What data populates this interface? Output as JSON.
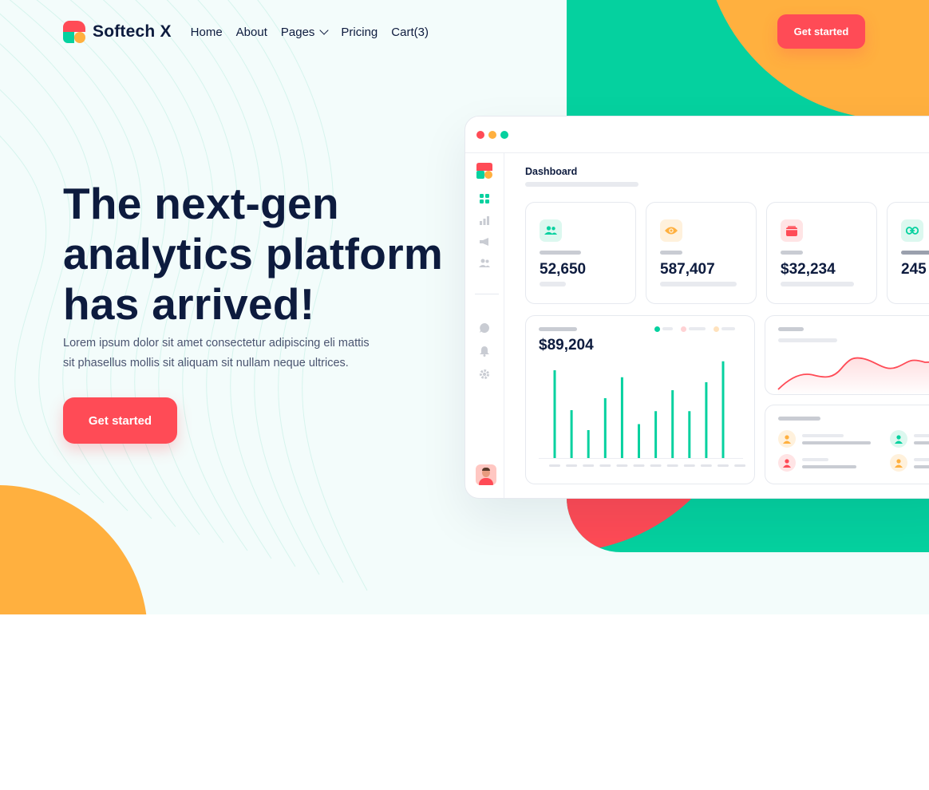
{
  "brand": {
    "name": "Softech X"
  },
  "nav": {
    "items": [
      {
        "label": "Home"
      },
      {
        "label": "About"
      },
      {
        "label": "Pages"
      },
      {
        "label": "Pricing"
      },
      {
        "label": "Cart(3)"
      }
    ],
    "cta_label": "Get started"
  },
  "hero": {
    "headline_lines": [
      "The next-gen",
      "analytics platform",
      "has arrived!"
    ],
    "subtext_lines": [
      "Lorem ipsum dolor sit amet consectetur adipiscing eli mattis",
      "sit phasellus mollis sit aliquam sit nullam neque ultrices."
    ],
    "cta_label": "Get started"
  },
  "colors": {
    "primary_red": "#ff4b56",
    "teal": "#05d19f",
    "orange": "#ffb03f",
    "navy": "#0d1b3e",
    "background": "#f3fcfb"
  },
  "dashboard": {
    "title": "Dashboard",
    "stats": [
      {
        "icon": "users-icon",
        "value": "52,650",
        "color": "#05d19f",
        "bg": "#dcf8ef"
      },
      {
        "icon": "eye-icon",
        "value": "587,407",
        "color": "#ffb03f",
        "bg": "#fff1dc"
      },
      {
        "icon": "wallet-icon",
        "value": "$32,234",
        "color": "#ff4b56",
        "bg": "#ffe4e5"
      },
      {
        "icon": "link-icon",
        "value": "245",
        "color": "#05d19f",
        "bg": "#dcf8ef"
      }
    ],
    "bar_panel": {
      "value": "$89,204"
    },
    "sidebar_icons": [
      "logo-icon",
      "grid-icon",
      "bar-chart-icon",
      "megaphone-icon",
      "users-icon",
      "chat-icon",
      "bell-icon",
      "gear-icon"
    ]
  },
  "chart_data": {
    "type": "bar",
    "title": "",
    "categories": [
      "",
      "",
      "",
      "",
      "",
      "",
      "",
      "",
      "",
      "",
      "",
      ""
    ],
    "values": [
      88,
      48,
      28,
      60,
      81,
      34,
      47,
      68,
      47,
      76,
      97
    ],
    "ylim": [
      0,
      100
    ],
    "grid": false,
    "color": "#05d19f"
  }
}
